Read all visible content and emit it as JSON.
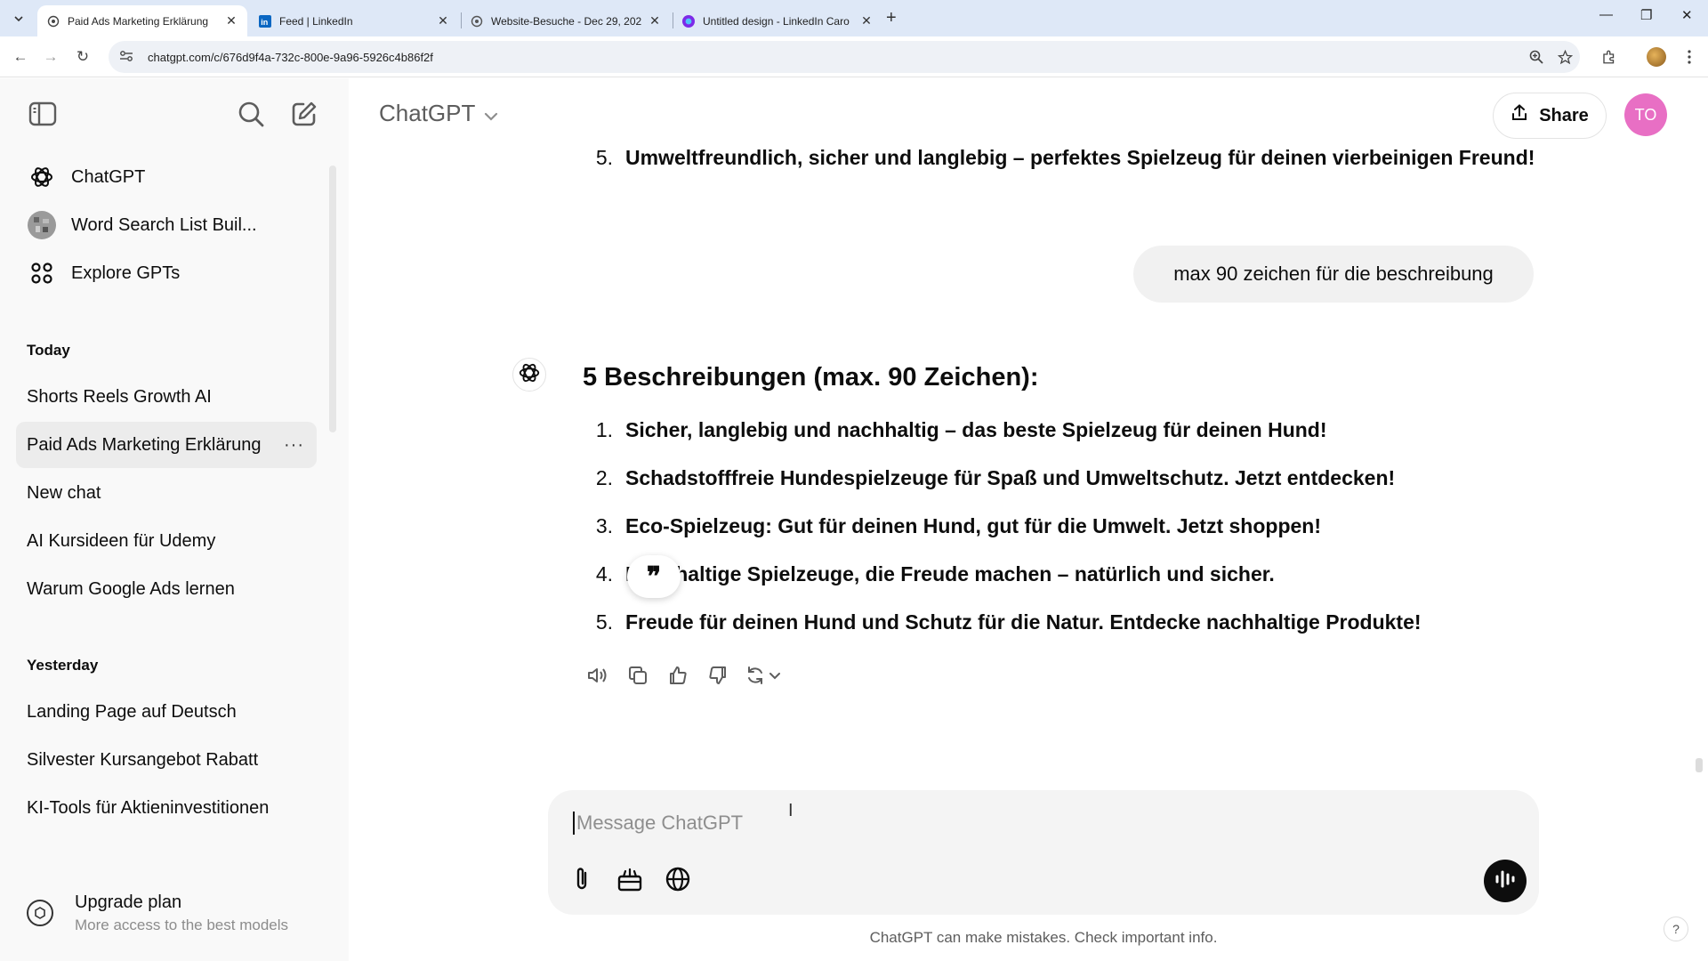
{
  "browser": {
    "tabs": [
      {
        "title": "Paid Ads Marketing Erklärung",
        "active": true
      },
      {
        "title": "Feed | LinkedIn",
        "active": false
      },
      {
        "title": "Website-Besuche - Dec 29, 202",
        "active": false
      },
      {
        "title": "Untitled design - LinkedIn Caro",
        "active": false
      }
    ],
    "url": "chatgpt.com/c/676d9f4a-732c-800e-9a96-5926c4b86f2f"
  },
  "sidebar": {
    "top_items": [
      {
        "label": "ChatGPT",
        "icon": "openai-logo-icon"
      },
      {
        "label": "Word Search List Buil...",
        "icon": "gpt-avatar-icon"
      },
      {
        "label": "Explore GPTs",
        "icon": "grid-icon"
      }
    ],
    "sections": [
      {
        "heading": "Today",
        "chats": [
          "Shorts Reels Growth AI",
          "Paid Ads Marketing Erklärung",
          "New chat",
          "AI Kursideen für Udemy",
          "Warum Google Ads lernen"
        ]
      },
      {
        "heading": "Yesterday",
        "chats": [
          "Landing Page auf Deutsch",
          "Silvester Kursangebot Rabatt",
          "KI-Tools für Aktieninvestitionen"
        ]
      }
    ],
    "active_chat": "Paid Ads Marketing Erklärung",
    "more_label": "···",
    "upgrade": {
      "title": "Upgrade plan",
      "subtitle": "More access to the best models"
    }
  },
  "header": {
    "model": "ChatGPT",
    "share_label": "Share",
    "avatar_initials": "TO"
  },
  "conversation": {
    "prev_last_item": {
      "num": "5.",
      "text": "Umweltfreundlich, sicher und langlebig – perfektes Spielzeug für deinen vierbeinigen Freund!"
    },
    "user_message": "max 90 zeichen für die beschreibung",
    "response_heading": "5 Beschreibungen (max. 90 Zeichen):",
    "response_items": [
      {
        "num": "1.",
        "text": "Sicher, langlebig und nachhaltig – das beste Spielzeug für deinen Hund!"
      },
      {
        "num": "2.",
        "text": "Schadstofffreie Hundespielzeuge für Spaß und Umweltschutz. Jetzt entdecken!"
      },
      {
        "num": "3.",
        "text": "Eco-Spielzeug: Gut für deinen Hund, gut für die Umwelt. Jetzt shoppen!"
      },
      {
        "num": "4.",
        "text": "Nachhaltige Spielzeuge, die Freude machen – natürlich und sicher."
      },
      {
        "num": "5.",
        "text": "Freude für deinen Hund und Schutz für die Natur. Entdecke nachhaltige Produkte!"
      }
    ],
    "quote_popup": "❞"
  },
  "composer": {
    "placeholder": "Message ChatGPT"
  },
  "footer_note": "ChatGPT can make mistakes. Check important info.",
  "help": "?",
  "colors": {
    "avatar": "#e86fc4",
    "sidebar_bg": "#f9f9f9",
    "composer_bg": "#f4f4f4"
  }
}
